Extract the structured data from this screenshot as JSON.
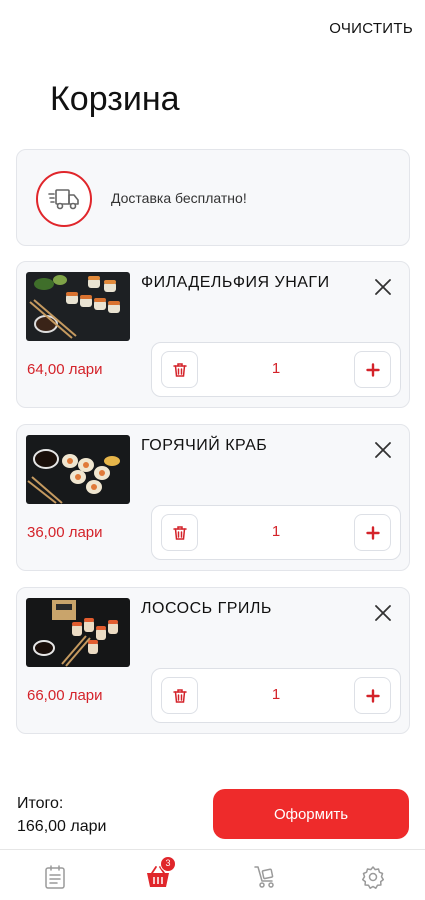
{
  "header": {
    "clear_label": "ОЧИСТИТЬ",
    "title": "Корзина"
  },
  "delivery": {
    "text": "Доставка бесплатно!",
    "icon": "delivery-truck-icon"
  },
  "items": [
    {
      "name": "ФИЛАДЕЛЬФИЯ УНАГИ",
      "price": "64,00 лари",
      "quantity": "1"
    },
    {
      "name": "ГОРЯЧИЙ КРАБ",
      "price": "36,00 лари",
      "quantity": "1"
    },
    {
      "name": "ЛОСОСЬ ГРИЛЬ",
      "price": "66,00 лари",
      "quantity": "1"
    }
  ],
  "summary": {
    "total_label": "Итого:",
    "total_value": "166,00 лари",
    "checkout_label": "Оформить"
  },
  "nav": {
    "items": [
      {
        "icon": "menu-list-icon",
        "active": false
      },
      {
        "icon": "cart-icon",
        "active": true,
        "badge": "3"
      },
      {
        "icon": "delivery-cart-icon",
        "active": false
      },
      {
        "icon": "settings-gear-icon",
        "active": false
      }
    ]
  },
  "colors": {
    "accent": "#ee2b2b",
    "price": "#d4232a",
    "card_bg": "#f7f8fa",
    "nav_inactive": "#9a9a9a"
  }
}
